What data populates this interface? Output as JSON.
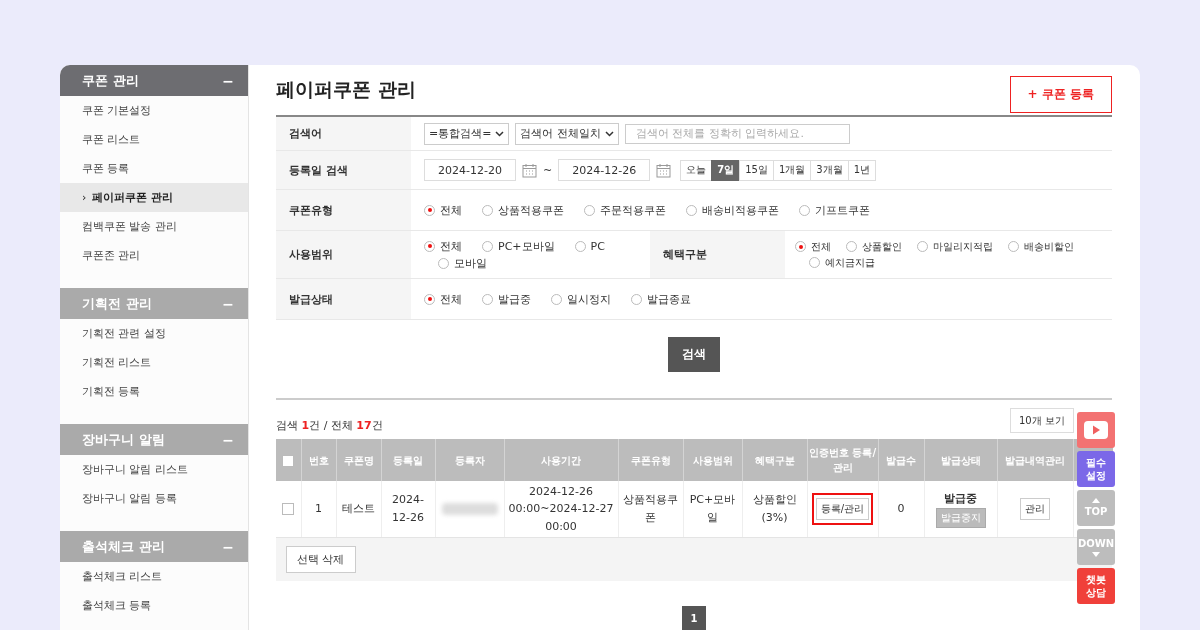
{
  "sidebar": {
    "selected_marker": "›",
    "groups": [
      {
        "title": "쿠폰 관리",
        "toggle": "−",
        "selected": true,
        "items": [
          {
            "label": "쿠폰 기본설정",
            "selected": false
          },
          {
            "label": "쿠폰 리스트",
            "selected": false
          },
          {
            "label": "쿠폰 등록",
            "selected": false
          },
          {
            "label": "페이퍼쿠폰 관리",
            "selected": true
          },
          {
            "label": "컴백쿠폰 발송 관리",
            "selected": false
          },
          {
            "label": "쿠폰존 관리",
            "selected": false
          }
        ]
      },
      {
        "title": "기획전 관리",
        "toggle": "−",
        "selected": false,
        "items": [
          {
            "label": "기획전 관련 설정",
            "selected": false
          },
          {
            "label": "기획전 리스트",
            "selected": false
          },
          {
            "label": "기획전 등록",
            "selected": false
          }
        ]
      },
      {
        "title": "장바구니 알림",
        "toggle": "−",
        "selected": false,
        "items": [
          {
            "label": "장바구니 알림 리스트",
            "selected": false
          },
          {
            "label": "장바구니 알림 등록",
            "selected": false
          }
        ]
      },
      {
        "title": "출석체크 관리",
        "toggle": "−",
        "selected": false,
        "items": [
          {
            "label": "출석체크 리스트",
            "selected": false
          },
          {
            "label": "출석체크 등록",
            "selected": false
          }
        ]
      }
    ]
  },
  "page": {
    "title": "페이퍼쿠폰 관리",
    "register_button": "+ 쿠폰 등록"
  },
  "search_form": {
    "keyword": {
      "label": "검색어",
      "selects": [
        "=통합검색=",
        "검색어 전체일치"
      ],
      "placeholder": "검색어 전체를 정확히 입력하세요."
    },
    "date": {
      "label": "등록일 검색",
      "from": "2024-12-20",
      "separator": "~",
      "to": "2024-12-26",
      "ranges": [
        {
          "label": "오늘",
          "selected": false
        },
        {
          "label": "7일",
          "selected": true
        },
        {
          "label": "15일",
          "selected": false
        },
        {
          "label": "1개월",
          "selected": false
        },
        {
          "label": "3개월",
          "selected": false
        },
        {
          "label": "1년",
          "selected": false
        }
      ]
    },
    "coupon_type": {
      "label": "쿠폰유형",
      "options": [
        {
          "label": "전체",
          "selected": true
        },
        {
          "label": "상품적용쿠폰",
          "selected": false
        },
        {
          "label": "주문적용쿠폰",
          "selected": false
        },
        {
          "label": "배송비적용쿠폰",
          "selected": false
        },
        {
          "label": "기프트쿠폰",
          "selected": false
        }
      ]
    },
    "usage_scope": {
      "label": "사용범위",
      "options": [
        {
          "label": "전체",
          "selected": true
        },
        {
          "label": "PC+모바일",
          "selected": false
        },
        {
          "label": "PC",
          "selected": false
        },
        {
          "label": "모바일",
          "selected": false
        }
      ]
    },
    "benefit_type": {
      "label": "혜택구분",
      "options": [
        {
          "label": "전체",
          "selected": true
        },
        {
          "label": "상품할인",
          "selected": false
        },
        {
          "label": "마일리지적립",
          "selected": false
        },
        {
          "label": "배송비할인",
          "selected": false
        },
        {
          "label": "예치금지급",
          "selected": false
        }
      ]
    },
    "issue_status": {
      "label": "발급상태",
      "options": [
        {
          "label": "전체",
          "selected": true
        },
        {
          "label": "발급중",
          "selected": false
        },
        {
          "label": "일시정지",
          "selected": false
        },
        {
          "label": "발급종료",
          "selected": false
        }
      ]
    },
    "search_button": "검색"
  },
  "results": {
    "summary": [
      {
        "text": "검색 ",
        "highlight": false
      },
      {
        "text": "1",
        "highlight": true
      },
      {
        "text": "건 / 전체 ",
        "highlight": false
      },
      {
        "text": "17",
        "highlight": true
      },
      {
        "text": "건",
        "highlight": false
      }
    ],
    "page_size": "10개 보기",
    "table": {
      "select_all": {
        "checked": false
      },
      "columns": [
        "번호",
        "쿠폰명",
        "등록일",
        "등록자",
        "사용기간",
        "쿠폰유형",
        "사용범위",
        "혜택구분",
        "인증번호 등록/관리",
        "발급수",
        "발급상태",
        "발급내역관리"
      ],
      "rows": [
        {
          "checked": false,
          "number": "1",
          "name": "테스트",
          "date": "2024-12-26",
          "period": "2024-12-26 00:00~2024-12-27 00:00",
          "coupon_type": "상품적용쿠폰",
          "scope": "PC+모바일",
          "benefit": "상품할인(3%)",
          "auth_button": "등록/관리",
          "auth_highlighted": true,
          "issued": "0",
          "status": "발급중",
          "stop_button": "발급중지",
          "history_button": "관리"
        }
      ]
    },
    "delete_button": "선택 삭제",
    "pages": [
      {
        "label": "1",
        "selected": true
      }
    ]
  },
  "floating": [
    {
      "kind": "youtube"
    },
    {
      "kind": "text",
      "label": "필수 설정",
      "color": "#7b68e8"
    },
    {
      "kind": "up",
      "label": "TOP",
      "color": "#bdbdbd"
    },
    {
      "kind": "down",
      "label": "DOWN",
      "color": "#bdbdbd"
    },
    {
      "kind": "text",
      "label": "챗봇 상담",
      "color": "#f0403a"
    }
  ]
}
